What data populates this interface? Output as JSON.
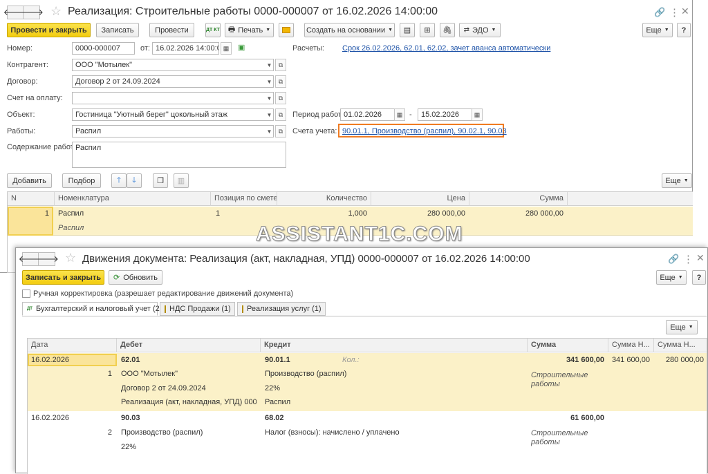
{
  "doc": {
    "title": "Реализация: Строительные работы 0000-000007 от 16.02.2026 14:00:00",
    "toolbar": {
      "post_close": "Провести и закрыть",
      "save": "Записать",
      "post": "Провести",
      "print": "Печать",
      "create_based": "Создать на основании",
      "edo": "ЭДО",
      "more": "Еще",
      "help": "?",
      "dtkt": "ДТ КТ"
    },
    "fields": {
      "number_label": "Номер:",
      "number": "0000-000007",
      "from_label": "от:",
      "date": "16.02.2026 14:00:00",
      "calc_label": "Расчеты:",
      "calc_link": "Срок 26.02.2026, 62.01, 62.02, зачет аванса автоматически",
      "counterparty_label": "Контрагент:",
      "counterparty": "ООО \"Мотылек\"",
      "contract_label": "Договор:",
      "contract": "Договор 2 от 24.09.2024",
      "invoice_label": "Счет на оплату:",
      "invoice": "",
      "object_label": "Объект:",
      "object": "Гостиница \"Уютный берег\" цокольный этаж",
      "period_label": "Период работ:",
      "period_from": "01.02.2026",
      "period_dash": "-",
      "period_to": "15.02.2026",
      "works_label": "Работы:",
      "works": "Распил",
      "accounts_label": "Счета учета:",
      "accounts_link": "90.01.1, Производство (распил), 90.02.1, 90.03",
      "content_label": "Содержание работ:",
      "content": "Распил"
    },
    "table_toolbar": {
      "add": "Добавить",
      "pick": "Подбор",
      "more": "Еще"
    },
    "table": {
      "headers": [
        "N",
        "Номенклатура",
        "Позиция по смете",
        "Количество",
        "Цена",
        "Сумма"
      ],
      "rows": [
        {
          "n": "1",
          "item": "Распил",
          "item_sub": "Распил",
          "position": "1",
          "qty": "1,000",
          "price": "280 000,00",
          "sum": "280 000,00"
        }
      ]
    }
  },
  "watermark": "ASSISTANT1C.COM",
  "moves": {
    "title": "Движения документа: Реализация (акт, накладная, УПД) 0000-000007 от 16.02.2026 14:00:00",
    "save_close": "Записать и закрыть",
    "refresh": "Обновить",
    "more": "Еще",
    "help": "?",
    "manual": "Ручная корректировка (разрешает редактирование движений документа)",
    "tabs": [
      "Бухгалтерский и налоговый учет (2)",
      "НДС Продажи (1)",
      "Реализация услуг (1)"
    ],
    "grid_more": "Еще",
    "headers": [
      "Дата",
      "Дебет",
      "Кредит",
      "Сумма",
      "Сумма Н...",
      "Сумма Н..."
    ],
    "rows": [
      {
        "date": "16.02.2026",
        "num": "1",
        "debit": "62.01",
        "debit_sub": [
          "ООО \"Мотылек\"",
          "Договор 2 от 24.09.2024",
          "Реализация (акт, накладная, УПД) 000..."
        ],
        "credit": "90.01.1",
        "qty_hint": "Кол.:",
        "credit_sub": [
          "Производство (распил)",
          "22%",
          "Распил"
        ],
        "sum": "341 600,00",
        "content": "Строительные работы",
        "sum_n1": "341 600,00",
        "sum_n2": "280 000,00"
      },
      {
        "date": "16.02.2026",
        "num": "2",
        "debit": "90.03",
        "debit_sub": [
          "Производство (распил)",
          "22%"
        ],
        "credit": "68.02",
        "credit_sub": [
          "Налог (взносы): начислено / уплачено"
        ],
        "sum": "61 600,00",
        "content": "Строительные работы",
        "sum_n1": "",
        "sum_n2": ""
      }
    ]
  }
}
